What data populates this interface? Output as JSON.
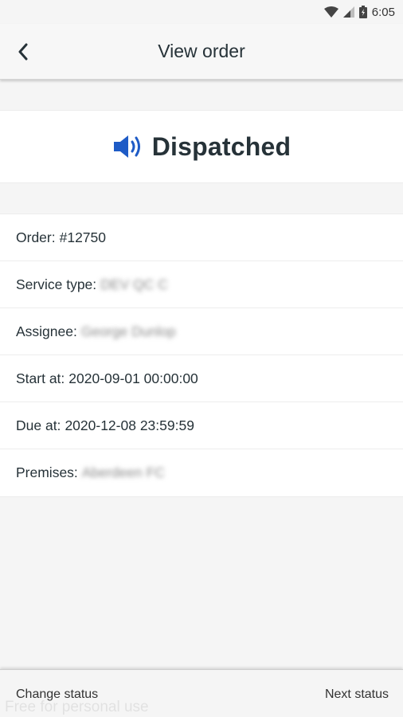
{
  "status_bar": {
    "time": "6:05",
    "icons": [
      "wifi-icon",
      "signal-icon",
      "battery-icon"
    ]
  },
  "app_bar": {
    "back_icon": "chevron-left-icon",
    "title": "View order"
  },
  "status": {
    "icon": "speaker-icon",
    "label": "Dispatched",
    "icon_color": "#1e5bc6"
  },
  "details": {
    "order_label": "Order:",
    "order_value": "#12750",
    "service_type_label": "Service type:",
    "service_type_value": "DEV QC C",
    "assignee_label": "Assignee:",
    "assignee_value": "George Dunlop",
    "start_label": "Start at:",
    "start_value": "2020-09-01 00:00:00",
    "due_label": "Due at:",
    "due_value": "2020-12-08 23:59:59",
    "premises_label": "Premises:",
    "premises_value": "Aberdeen FC"
  },
  "bottom_bar": {
    "change_status": "Change status",
    "next_status": "Next status",
    "watermark": "Free for personal use"
  }
}
